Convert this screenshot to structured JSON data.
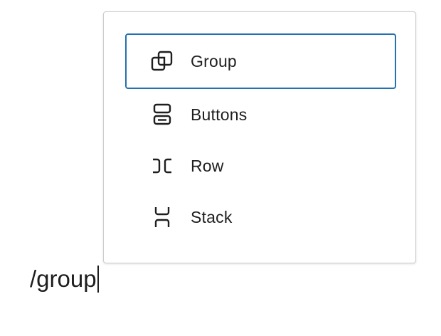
{
  "menu": {
    "items": [
      {
        "label": "Group",
        "icon": "group-icon",
        "selected": true
      },
      {
        "label": "Buttons",
        "icon": "buttons-icon",
        "selected": false
      },
      {
        "label": "Row",
        "icon": "row-icon",
        "selected": false
      },
      {
        "label": "Stack",
        "icon": "stack-icon",
        "selected": false
      }
    ]
  },
  "editor": {
    "input_text": "/group"
  },
  "colors": {
    "accent": "#2271b1",
    "text": "#1e1e1e",
    "border": "#cccccc"
  }
}
